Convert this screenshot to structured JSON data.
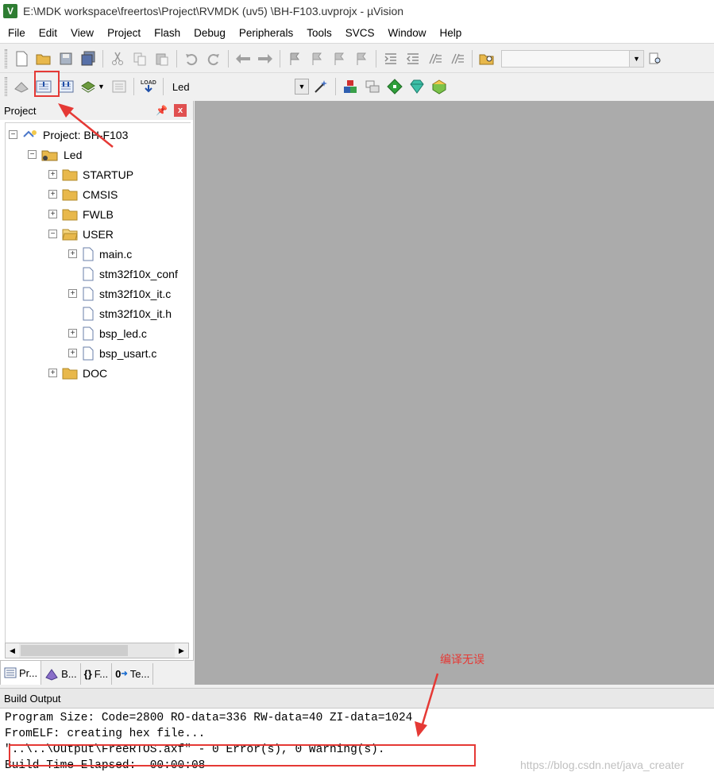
{
  "window": {
    "title": "E:\\MDK workspace\\freertos\\Project\\RVMDK  (uv5)  \\BH-F103.uvprojx - µVision",
    "app_icon_label": "V"
  },
  "menu": [
    "File",
    "Edit",
    "View",
    "Project",
    "Flash",
    "Debug",
    "Peripherals",
    "Tools",
    "SVCS",
    "Window",
    "Help"
  ],
  "toolbar2": {
    "target_select": "Led"
  },
  "project_panel": {
    "title": "Project",
    "pin_glyph": "📌",
    "close_glyph": "x",
    "tree": {
      "project": "Project: BH-F103",
      "target": "Led",
      "groups": {
        "startup": "STARTUP",
        "cmsis": "CMSIS",
        "fwlb": "FWLB",
        "user": "USER",
        "doc": "DOC"
      },
      "user_files": {
        "main": "main.c",
        "conf": "stm32f10x_conf",
        "it_c": "stm32f10x_it.c",
        "it_h": "stm32f10x_it.h",
        "bsp_led": "bsp_led.c",
        "bsp_usart": "bsp_usart.c"
      }
    },
    "tabs": {
      "project": "Pr...",
      "books": "B...",
      "functions": "F...",
      "templates": "Te..."
    },
    "tab_icon_text": {
      "functions": "{}",
      "templates": "0"
    }
  },
  "annotation": {
    "label": "编译无误",
    "color": "#e53935"
  },
  "build_output": {
    "title": "Build Output",
    "lines": {
      "l1": "Program Size: Code=2800 RO-data=336 RW-data=40 ZI-data=1024",
      "l2": "FromELF: creating hex file...",
      "l3": "\"..\\..\\Output\\FreeRTOS.axf\" - 0 Error(s), 0 Warning(s).",
      "l4": "Build Time Elapsed:  00:00:08"
    }
  },
  "watermark": "https://blog.csdn.net/java_creater",
  "colors": {
    "editor_bg": "#ababab",
    "highlight": "#e53935",
    "folder": "#e8b84b"
  }
}
